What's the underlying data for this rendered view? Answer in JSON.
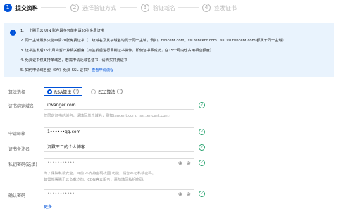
{
  "steps": [
    {
      "num": "1",
      "label": "提交资料"
    },
    {
      "num": "2",
      "label": "选择验证方式"
    },
    {
      "num": "3",
      "label": "验证域名"
    },
    {
      "num": "4",
      "label": "签发证书"
    }
  ],
  "info": {
    "lines": [
      "1. 一个腾讯云 UIN 账户最多只能申请50张免费证书",
      "2. 同一主域最多只能申请20张免费证书（二级域名及其子域名均属于同一主域，例如，tencent.com、ssl.tencent.com、ssl.ssl.tencent.com 都属于同一主域）",
      "3. 证书签发后15个月内暂计算相关额度（如签发后进行吊销证书操作，即使证书吊成功，在15个月内也占用相应额度）",
      "4. 免费证书仅支持单域名，若需申请泛域名证书，请购买付费证书",
      "5. 如何申请域名型（DV）免费 SSL 证书？"
    ],
    "link": "查看申请流程"
  },
  "form": {
    "algo_label": "算法选择",
    "algo_options": [
      "RSA算法",
      "ECC算法"
    ],
    "domain_label": "证书绑定域名",
    "domain_value": "itwanger.com",
    "domain_hint": "仅限定证书的域名，请填写单个域名，例如tencent.com、ssl.tencent.com。",
    "email_label": "申请邮箱",
    "email_value": "1••••••qq.com",
    "remark_label": "证书备注名",
    "remark_value": "沉默王二的个人博客",
    "pwd_label": "私钥密码(选填)",
    "pwd_value": "•••••••••••",
    "pwd_hint1": "为了保障私钥安全，目前 不支持密码找回 功能，请您牢记私钥密码。",
    "pwd_hint2": "如需部署腾讯云负载均衡、CDN等云服务，请勿填写私钥密码。",
    "confirm_label": "确认密码",
    "confirm_value": "•••••••••••",
    "more": "更多"
  },
  "colors": {
    "accent": "#0052d9",
    "success": "#2ba471",
    "info_bg": "#e9f3fd"
  },
  "icons": {
    "check": "check-circle-icon",
    "clear": "clear-icon",
    "eye": "eye-off-icon",
    "help": "help-icon"
  }
}
